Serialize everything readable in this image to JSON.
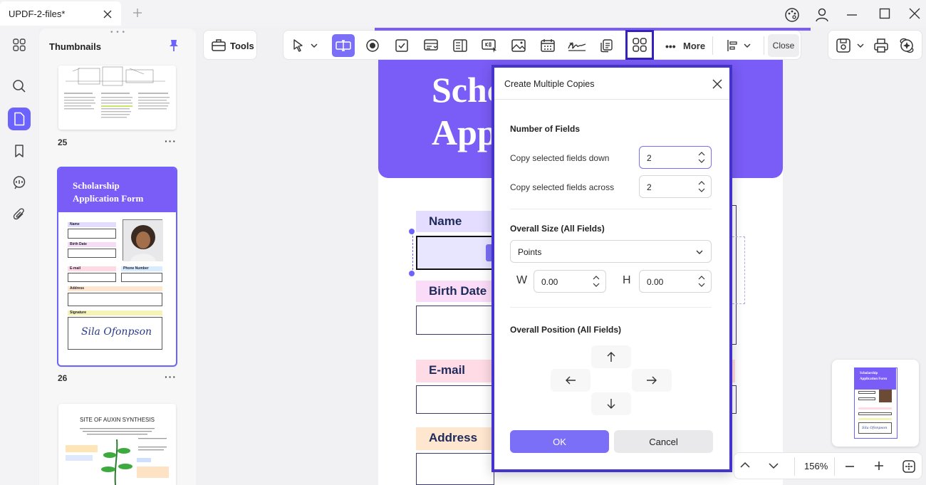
{
  "window": {
    "tab_title": "UPDF-2-files*"
  },
  "sidebar": {
    "panel_title": "Thumbnails",
    "pages": [
      {
        "number": "25",
        "more": "···"
      },
      {
        "number": "26",
        "more": "···"
      }
    ],
    "thumb26": {
      "title_line1": "Scholarship",
      "title_line2": "Application Form",
      "name_label": "Name",
      "birth_label": "Birth Date",
      "email_label": "E-mail",
      "phone_label": "Phone Number",
      "address_label": "Address",
      "signature_label": "Signature",
      "signature_text": "Sila Ofonpson"
    },
    "thumb27": {
      "title": "SITE OF AUXIN SYNTHESIS"
    }
  },
  "toolbar": {
    "tools_label": "Tools",
    "more_label": "More",
    "close_label": "Close"
  },
  "document": {
    "banner_line1": "Schc",
    "banner_line2": "App",
    "fields": {
      "name": "Name",
      "birth_date": "Birth Date",
      "email": "E-mail",
      "address": "Address"
    }
  },
  "dialog": {
    "title": "Create Multiple Copies",
    "number_of_fields_heading": "Number of Fields",
    "copy_down_label": "Copy selected fields down",
    "copy_down_value": "2",
    "copy_across_label": "Copy selected fields across",
    "copy_across_value": "2",
    "overall_size_heading": "Overall Size (All Fields)",
    "units_value": "Points",
    "w_label": "W",
    "w_value": "0.00",
    "h_label": "H",
    "h_value": "0.00",
    "overall_position_heading": "Overall Position (All Fields)",
    "ok_label": "OK",
    "cancel_label": "Cancel"
  },
  "minimap": {
    "title_line1": "Scholarship",
    "title_line2": "Application Form",
    "signature_text": "Sila Ofonpson"
  },
  "zoom": {
    "level": "156%"
  },
  "colors": {
    "accent": "#6c63ff",
    "banner": "#7a5cf6",
    "dialog_border": "#4433cc"
  }
}
